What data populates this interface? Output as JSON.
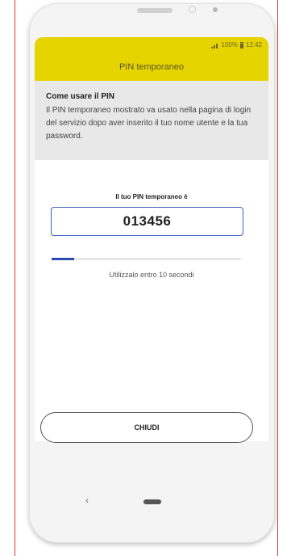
{
  "status_bar": {
    "battery": "100%",
    "time": "12:42"
  },
  "header": {
    "title": "PIN temporaneo"
  },
  "info": {
    "title": "Come usare il PIN",
    "body": "Il PIN temporaneo mostrato va usato nella pagina di login del servizio dopo aver inserito il tuo nome utente e la tua password."
  },
  "pin": {
    "label": "Il tuo PIN temporaneo è",
    "value": "013456"
  },
  "timer": {
    "progress_fraction": 0.12,
    "caption": "Utilizzalo entro 10 secondi"
  },
  "actions": {
    "close_label": "CHIUDI"
  },
  "nav": {
    "back_glyph": "‹"
  },
  "colors": {
    "accent_yellow": "#e6d400",
    "progress_blue": "#2c4cb5",
    "pin_border": "#3d5fbf"
  },
  "icons": {
    "signal": "signal-icon",
    "battery": "battery-icon",
    "back": "back-icon",
    "home": "home-icon"
  }
}
